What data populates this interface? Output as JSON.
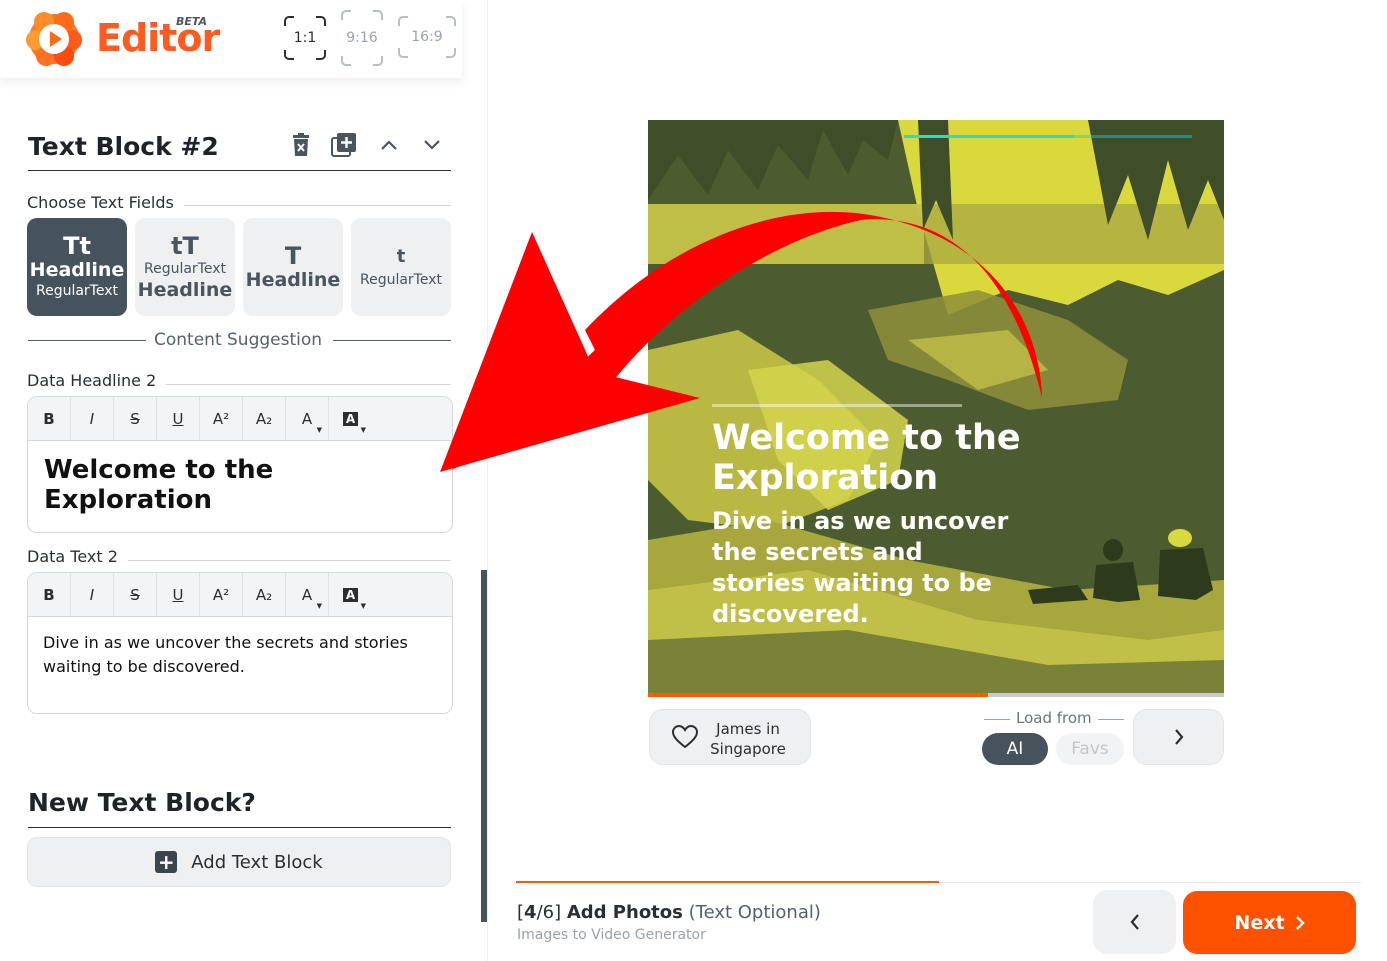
{
  "app": {
    "name": "Editor",
    "badge": "BETA",
    "accent_color": "#ff5a1f"
  },
  "aspect_ratios": [
    {
      "label": "1:1",
      "active": true
    },
    {
      "label": "9:16",
      "active": false
    },
    {
      "label": "16:9",
      "active": false
    }
  ],
  "text_block": {
    "title": "Text Block #2",
    "actions": [
      "delete-icon",
      "duplicate-icon",
      "move-up-icon",
      "move-down-icon"
    ],
    "choose_fields_label": "Choose Text Fields",
    "field_options": [
      {
        "glyph": "Tt",
        "line1": "Headline",
        "line2": "RegularText",
        "active": true
      },
      {
        "glyph": "tT",
        "line1": "RegularText",
        "line2": "Headline",
        "active": false
      },
      {
        "glyph": "T",
        "line1": "Headline",
        "active": false
      },
      {
        "glyph": "t",
        "line1": "RegularText",
        "active": false
      }
    ],
    "content_suggestion_label": "Content Suggestion",
    "headline_label": "Data Headline 2",
    "headline_value": "Welcome to the Exploration",
    "text_label": "Data Text 2",
    "text_value": "Dive in as we uncover the secrets and stories waiting to be discovered."
  },
  "toolbar_buttons": [
    "B",
    "I",
    "S",
    "U",
    "A²",
    "A₂",
    "A",
    "A"
  ],
  "new_block": {
    "title": "New Text Block?",
    "button_label": "Add Text Block"
  },
  "preview": {
    "headline": "Welcome to the Exploration",
    "text": "Dive in as we uncover the secrets and stories waiting to be discovered.",
    "progress_fraction": 0.59,
    "overlay_color": "#4a5a2e",
    "highlight_color": "#d6d63a"
  },
  "photo_credit": {
    "line1": "James in",
    "line2": "Singapore"
  },
  "load_from": {
    "label": "Load from",
    "options": [
      {
        "label": "AI",
        "active": true
      },
      {
        "label": "Favs",
        "active": false
      }
    ]
  },
  "footer": {
    "step_current": "4",
    "step_total": "6",
    "step_title": "Add Photos",
    "step_optional": "(Text Optional)",
    "subtitle": "Images to Video Generator",
    "next_label": "Next",
    "progress_fraction": 0.5,
    "next_color": "#ff5200"
  }
}
